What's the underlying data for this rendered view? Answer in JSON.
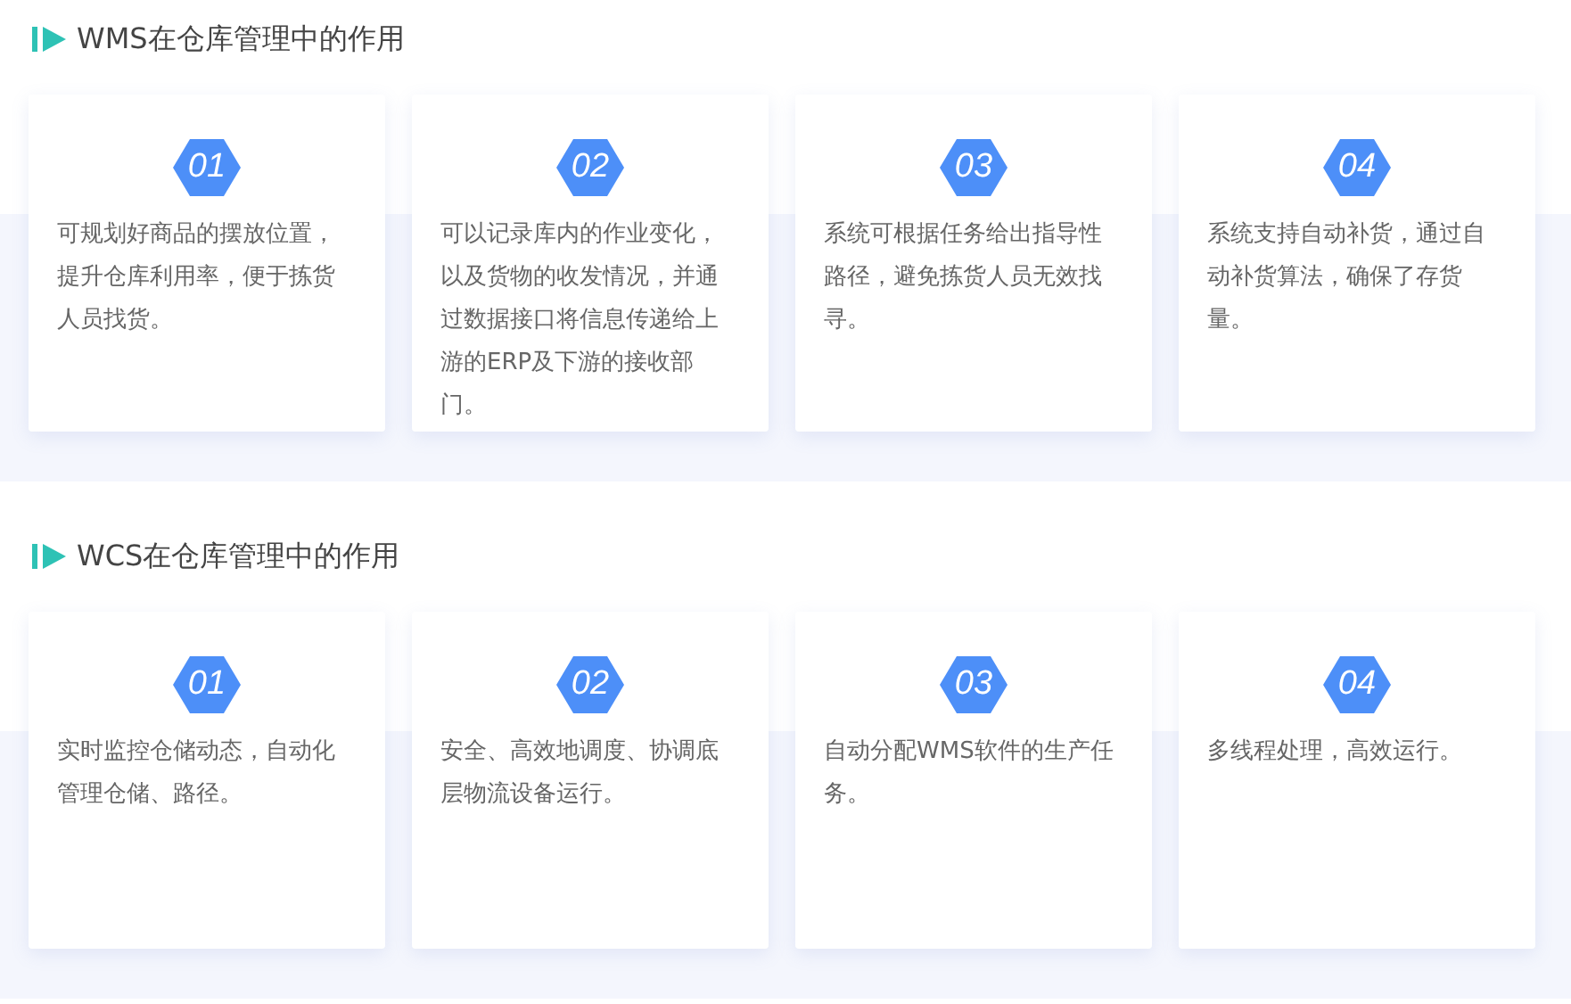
{
  "sections": [
    {
      "title": "WMS在仓库管理中的作用",
      "cards": [
        {
          "number": "01",
          "text": "可规划好商品的摆放位置，提升仓库利用率，便于拣货人员找货。"
        },
        {
          "number": "02",
          "text": "可以记录库内的作业变化，以及货物的收发情况，并通过数据接口将信息传递给上游的ERP及下游的接收部门。"
        },
        {
          "number": "03",
          "text": "系统可根据任务给出指导性路径，避免拣货人员无效找寻。"
        },
        {
          "number": "04",
          "text": "系统支持自动补货，通过自动补货算法，确保了存货量。"
        }
      ]
    },
    {
      "title": "WCS在仓库管理中的作用",
      "cards": [
        {
          "number": "01",
          "text": "实时监控仓储动态，自动化管理仓储、路径。"
        },
        {
          "number": "02",
          "text": "安全、高效地调度、协调底层物流设备运行。"
        },
        {
          "number": "03",
          "text": "自动分配WMS软件的生产任务。"
        },
        {
          "number": "04",
          "text": "多线程处理，高效运行。"
        }
      ]
    }
  ]
}
